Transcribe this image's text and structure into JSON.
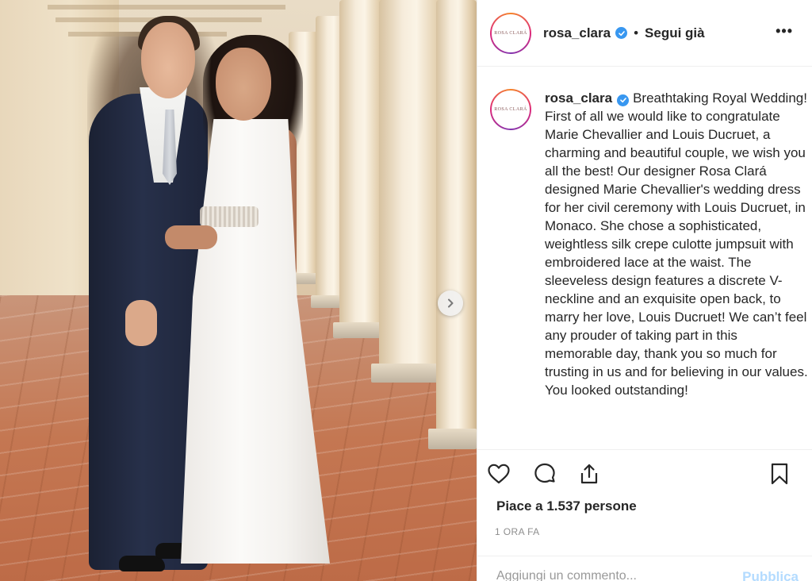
{
  "header": {
    "avatar_text": "ROSA CLARÁ",
    "username": "rosa_clara",
    "separator": "•",
    "follow_label": "Segui già",
    "more_label": "•••"
  },
  "caption": {
    "username": "rosa_clara",
    "text": "Breathtaking Royal Wedding! First of all we would like to congratulate Marie Chevallier and Louis Ducruet, a charming and beautiful couple, we wish you all the best! Our designer Rosa Clará designed Marie Chevallier's wedding dress for her civil ceremony with Louis Ducruet, in Monaco. She chose a sophisticated, weightless silk crepe culotte jumpsuit with embroidered lace at the waist. The sleeveless design features a discrete V-neckline and an exquisite open back, to marry her love, Louis Ducruet! We can’t feel any prouder of taking part in this memorable day, thank you so much for trusting in us and for believing in our values. You looked outstanding!"
  },
  "actions": {
    "icons": [
      "heart-icon",
      "comment-icon",
      "share-icon",
      "bookmark-icon"
    ]
  },
  "likes_text": "Piace a 1.537 persone",
  "time_text": "1 ORA FA",
  "comment": {
    "placeholder": "Aggiungi un commento...",
    "publish_label": "Pubblica"
  },
  "colors": {
    "verified": "#3897f0",
    "publish_disabled": "#b3dbff",
    "muted": "#8e8e8e"
  }
}
